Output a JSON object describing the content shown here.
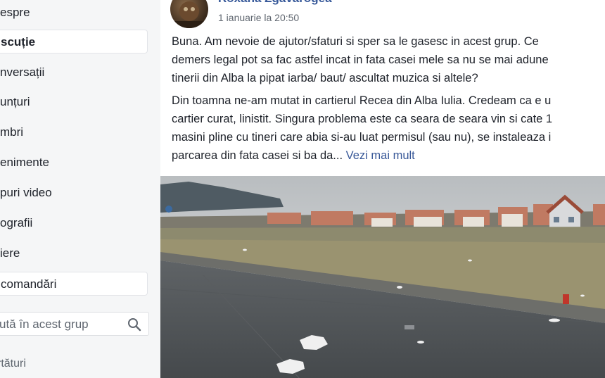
{
  "sidebar": {
    "items": [
      {
        "label": "espre"
      },
      {
        "label": "scuție"
      },
      {
        "label": "nversații"
      },
      {
        "label": "unțuri"
      },
      {
        "label": "mbri"
      },
      {
        "label": "enimente"
      },
      {
        "label": "puri video"
      },
      {
        "label": "ografii"
      },
      {
        "label": "iere"
      },
      {
        "label": "comandări"
      }
    ],
    "search_placeholder": "ută în acest grup",
    "shortcuts_label": "rtături"
  },
  "post": {
    "author": "Roxana Zgavarogea",
    "date": "1 ianuarie la 20:50",
    "paragraph1": "Buna. Am nevoie de ajutor/sfaturi si sper sa le gasesc in acest grup. Ce\ndemers legal pot sa fac astfel incat in fata casei mele sa nu se mai adune\ntinerii din Alba la pipat iarba/ baut/ ascultat muzica si altele?",
    "paragraph2": "Din toamna ne-am mutat in cartierul Recea din Alba Iulia. Credeam ca e u\ncartier curat, linistit. Singura problema este ca seara de seara vin si cate 1\nmasini pline cu tineri care abia si-au luat permisul (sau nu), se instaleaza i\nparcarea din fata casei si ba da...",
    "see_more": "Vezi mai mult",
    "link_color": "#365899"
  }
}
